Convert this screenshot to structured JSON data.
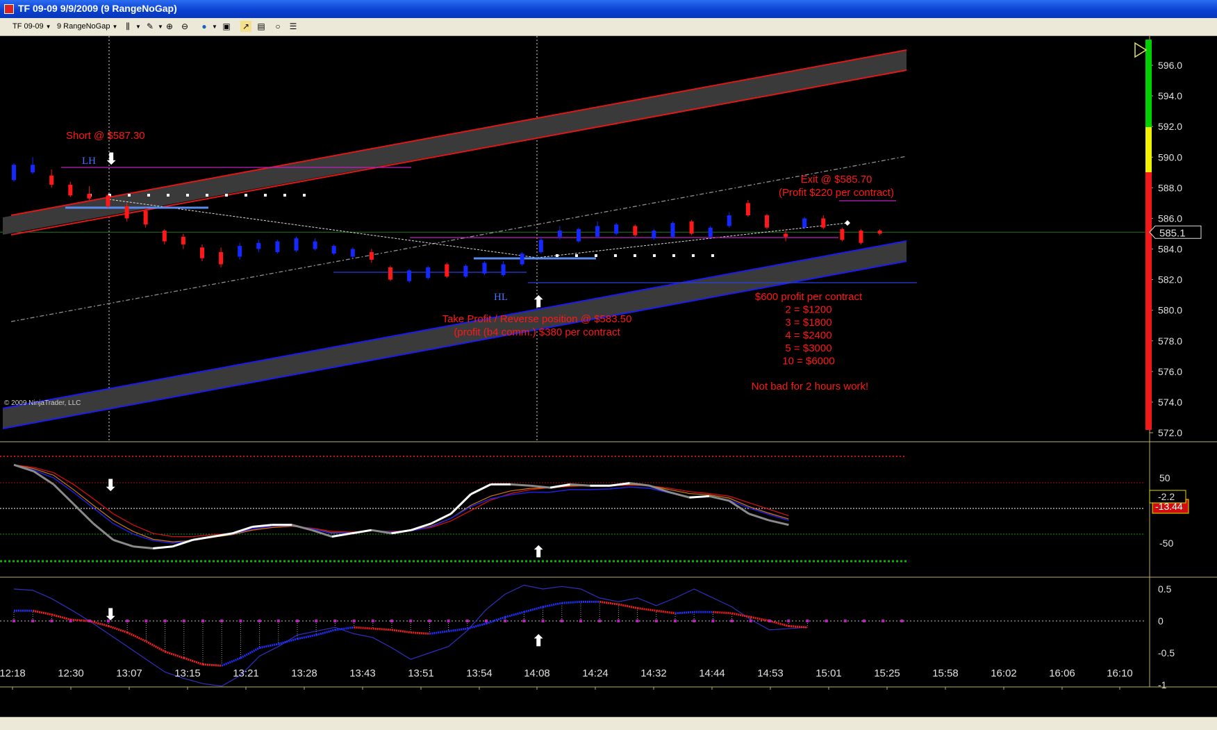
{
  "window": {
    "title": "TF 09-09  9/9/2009 (9 RangeNoGap)"
  },
  "toolbar": {
    "instrument": "TF 09-09",
    "interval": "9 RangeNoGap"
  },
  "chart_data": {
    "type": "bar",
    "price_scale": [
      "596.0",
      "594.0",
      "592.0",
      "590.0",
      "588.0",
      "586.0",
      "584.0",
      "582.0",
      "580.0",
      "578.0",
      "576.0",
      "574.0",
      "572.0"
    ],
    "current_price_label": "585.1",
    "copyright": "© 2009 NinjaTrader, LLC",
    "time_labels": [
      "12:18",
      "12:30",
      "13:07",
      "13:15",
      "13:21",
      "13:28",
      "13:43",
      "13:51",
      "13:54",
      "14:08",
      "14:24",
      "14:32",
      "14:44",
      "14:53",
      "15:01",
      "15:25",
      "15:58",
      "16:02",
      "16:06",
      "16:10"
    ],
    "osc1_scale": [
      "50",
      "-50"
    ],
    "osc1_value_labels": [
      "-2.2",
      "-13.44"
    ],
    "osc2_scale": [
      "0.5",
      "0",
      "-0.5",
      "-1"
    ],
    "annotations": {
      "short": "Short @ $587.30",
      "lh": "LH",
      "hl": "HL",
      "take_profit_1": "Take Profit / Reverse position @ $583.50",
      "take_profit_2": "(profit (b4 comm.) $380 per contract",
      "exit_1": "Exit @ $585.70",
      "exit_2": "(Profit $220 per contract)",
      "summary": [
        "$600 profit per contract",
        "2 = $1200",
        "3 = $1800",
        "4 = $2400",
        "5 = $3000",
        "10 = $6000"
      ],
      "closing": "Not bad for 2 hours work!"
    },
    "bars": [
      {
        "o": 588.5,
        "c": 589.5,
        "h": 589.6,
        "l": 588.4,
        "up": true
      },
      {
        "o": 589.0,
        "c": 589.5,
        "h": 590.0,
        "l": 588.9,
        "up": true
      },
      {
        "o": 588.8,
        "c": 588.2,
        "h": 589.2,
        "l": 588.0,
        "up": false
      },
      {
        "o": 588.2,
        "c": 587.5,
        "h": 588.4,
        "l": 587.4,
        "up": false
      },
      {
        "o": 587.6,
        "c": 587.3,
        "h": 588.1,
        "l": 587.2,
        "up": false
      },
      {
        "o": 587.5,
        "c": 586.8,
        "h": 587.6,
        "l": 586.7,
        "up": false
      },
      {
        "o": 586.8,
        "c": 586.0,
        "h": 587.0,
        "l": 585.8,
        "up": false
      },
      {
        "o": 586.5,
        "c": 585.6,
        "h": 586.7,
        "l": 585.4,
        "up": false
      },
      {
        "o": 585.2,
        "c": 584.5,
        "h": 585.3,
        "l": 584.3,
        "up": false
      },
      {
        "o": 584.8,
        "c": 584.3,
        "h": 585.0,
        "l": 584.0,
        "up": false
      },
      {
        "o": 584.1,
        "c": 583.4,
        "h": 584.3,
        "l": 583.2,
        "up": false
      },
      {
        "o": 583.8,
        "c": 583.0,
        "h": 584.1,
        "l": 582.8,
        "up": false
      },
      {
        "o": 583.5,
        "c": 584.2,
        "h": 584.4,
        "l": 583.3,
        "up": true
      },
      {
        "o": 584.0,
        "c": 584.4,
        "h": 584.6,
        "l": 583.8,
        "up": true
      },
      {
        "o": 583.8,
        "c": 584.5,
        "h": 584.6,
        "l": 583.7,
        "up": true
      },
      {
        "o": 583.9,
        "c": 584.7,
        "h": 584.8,
        "l": 583.8,
        "up": true
      },
      {
        "o": 584.0,
        "c": 584.5,
        "h": 584.7,
        "l": 583.9,
        "up": true
      },
      {
        "o": 583.7,
        "c": 584.2,
        "h": 584.3,
        "l": 583.6,
        "up": true
      },
      {
        "o": 583.5,
        "c": 584.0,
        "h": 584.1,
        "l": 583.4,
        "up": true
      },
      {
        "o": 583.8,
        "c": 583.3,
        "h": 584.0,
        "l": 583.1,
        "up": false
      },
      {
        "o": 582.8,
        "c": 582.0,
        "h": 582.9,
        "l": 581.9,
        "up": false
      },
      {
        "o": 581.9,
        "c": 582.6,
        "h": 582.7,
        "l": 581.8,
        "up": true
      },
      {
        "o": 582.1,
        "c": 582.8,
        "h": 582.9,
        "l": 582.0,
        "up": true
      },
      {
        "o": 583.0,
        "c": 582.2,
        "h": 583.1,
        "l": 582.1,
        "up": false
      },
      {
        "o": 582.2,
        "c": 582.9,
        "h": 583.0,
        "l": 582.1,
        "up": true
      },
      {
        "o": 582.4,
        "c": 583.1,
        "h": 583.2,
        "l": 582.3,
        "up": true
      },
      {
        "o": 582.3,
        "c": 583.0,
        "h": 583.2,
        "l": 582.2,
        "up": true
      },
      {
        "o": 583.0,
        "c": 583.7,
        "h": 583.8,
        "l": 582.9,
        "up": true
      },
      {
        "o": 583.8,
        "c": 584.6,
        "h": 584.8,
        "l": 583.7,
        "up": true
      },
      {
        "o": 584.8,
        "c": 585.2,
        "h": 585.5,
        "l": 584.6,
        "up": true
      },
      {
        "o": 584.5,
        "c": 585.3,
        "h": 585.4,
        "l": 584.4,
        "up": true
      },
      {
        "o": 584.8,
        "c": 585.5,
        "h": 585.8,
        "l": 584.7,
        "up": true
      },
      {
        "o": 585.0,
        "c": 585.6,
        "h": 585.7,
        "l": 584.9,
        "up": true
      },
      {
        "o": 585.5,
        "c": 584.9,
        "h": 585.6,
        "l": 584.8,
        "up": false
      },
      {
        "o": 584.7,
        "c": 585.2,
        "h": 585.3,
        "l": 584.6,
        "up": true
      },
      {
        "o": 584.8,
        "c": 585.7,
        "h": 585.8,
        "l": 584.7,
        "up": true
      },
      {
        "o": 585.8,
        "c": 585.0,
        "h": 585.9,
        "l": 584.9,
        "up": false
      },
      {
        "o": 584.8,
        "c": 585.4,
        "h": 585.5,
        "l": 584.7,
        "up": true
      },
      {
        "o": 585.5,
        "c": 586.2,
        "h": 586.4,
        "l": 585.4,
        "up": true
      },
      {
        "o": 587.0,
        "c": 586.2,
        "h": 587.2,
        "l": 586.1,
        "up": false
      },
      {
        "o": 586.2,
        "c": 585.4,
        "h": 586.3,
        "l": 585.3,
        "up": false
      },
      {
        "o": 585.0,
        "c": 584.8,
        "h": 585.2,
        "l": 584.5,
        "up": false
      },
      {
        "o": 585.4,
        "c": 586.0,
        "h": 586.1,
        "l": 585.3,
        "up": true
      },
      {
        "o": 586.0,
        "c": 585.4,
        "h": 586.2,
        "l": 585.3,
        "up": false
      },
      {
        "o": 585.3,
        "c": 584.6,
        "h": 585.4,
        "l": 584.5,
        "up": false
      },
      {
        "o": 585.2,
        "c": 584.4,
        "h": 585.3,
        "l": 584.3,
        "up": false
      },
      {
        "o": 585.0,
        "c": 585.2,
        "h": 585.3,
        "l": 584.9,
        "up": false
      }
    ],
    "osc1": {
      "gray": [
        70,
        60,
        40,
        10,
        -20,
        -45,
        -55,
        -58,
        -55,
        -45,
        -40,
        -35,
        -25,
        -22,
        -22,
        -30,
        -40,
        -35,
        -30,
        -35,
        -30,
        -20,
        -5,
        25,
        40,
        40,
        38,
        35,
        40,
        38,
        38,
        42,
        38,
        28,
        20,
        22,
        15,
        -5,
        -15,
        -22
      ],
      "white": [
        70,
        60,
        40,
        10,
        -20,
        -45,
        -55,
        -58,
        -55,
        -45,
        -40,
        -35,
        -25,
        -22,
        -22,
        -30,
        -40,
        -35,
        -30,
        -35,
        -30,
        -20,
        -5,
        25,
        40,
        40,
        38,
        35,
        40,
        38,
        38,
        42,
        38,
        28,
        20,
        22,
        15,
        -5,
        -15,
        -22
      ],
      "red": [
        70,
        66,
        58,
        40,
        18,
        -5,
        -22,
        -35,
        -40,
        -40,
        -37,
        -35,
        -30,
        -26,
        -24,
        -27,
        -32,
        -33,
        -31,
        -32,
        -31,
        -26,
        -16,
        0,
        16,
        26,
        32,
        35,
        37,
        38,
        38,
        39,
        38,
        34,
        29,
        26,
        22,
        12,
        2,
        -8
      ],
      "brown": [
        70,
        64,
        54,
        32,
        8,
        -15,
        -32,
        -44,
        -48,
        -46,
        -41,
        -37,
        -30,
        -26,
        -24,
        -28,
        -34,
        -34,
        -31,
        -33,
        -31,
        -24,
        -12,
        8,
        22,
        30,
        34,
        35,
        38,
        38,
        38,
        40,
        38,
        32,
        26,
        24,
        19,
        6,
        -4,
        -13
      ],
      "blue": [
        70,
        62,
        50,
        28,
        4,
        -20,
        -36,
        -46,
        -50,
        -46,
        -40,
        -36,
        -28,
        -24,
        -23,
        -28,
        -35,
        -34,
        -30,
        -33,
        -31,
        -25,
        -12,
        6,
        18,
        24,
        28,
        28,
        32,
        32,
        33,
        36,
        34,
        27,
        21,
        21,
        16,
        4,
        -6,
        -15
      ]
    }
  }
}
